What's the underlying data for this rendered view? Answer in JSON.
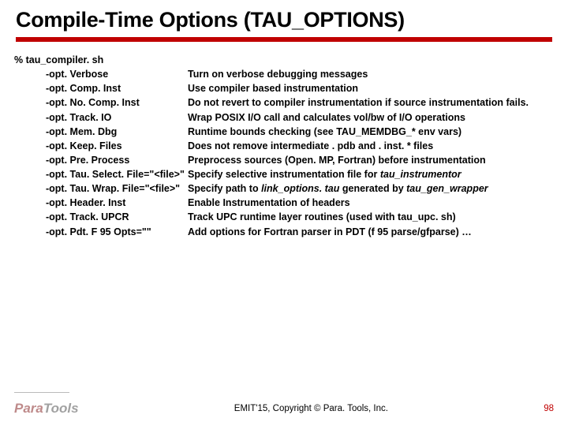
{
  "title": "Compile-Time Options (TAU_OPTIONS)",
  "cmd": "% tau_compiler. sh",
  "options": [
    {
      "flag": "-opt. Verbose",
      "desc": "Turn on verbose debugging messages"
    },
    {
      "flag": "-opt. Comp. Inst",
      "desc": "Use compiler based instrumentation"
    },
    {
      "flag": "-opt. No. Comp. Inst",
      "desc": "Do not revert to compiler instrumentation if source instrumentation fails."
    },
    {
      "flag": "-opt. Track. IO",
      "desc": "Wrap POSIX I/O call and calculates vol/bw of I/O operations"
    },
    {
      "flag": "-opt. Mem. Dbg",
      "desc": "Runtime bounds checking (see TAU_MEMDBG_* env vars)"
    },
    {
      "flag": "-opt. Keep. Files",
      "desc": "Does not remove intermediate . pdb and . inst. * files"
    },
    {
      "flag": "-opt. Pre. Process",
      "desc": "Preprocess sources (Open. MP, Fortran) before instrumentation"
    },
    {
      "flag": "-opt. Tau. Select. File=\"<file>\"",
      "desc_pre": "Specify selective instrumentation file for ",
      "desc_it": "tau_instrumentor"
    },
    {
      "flag": "-opt. Tau. Wrap. File=\"<file>\"",
      "desc_pre": "Specify path to ",
      "desc_it": "link_options. tau",
      "desc_post": " generated by ",
      "desc_it2": "tau_gen_wrapper"
    },
    {
      "flag": "-opt. Header. Inst",
      "desc": "Enable Instrumentation of headers"
    },
    {
      "flag": "-opt. Track. UPCR",
      "desc": "Track UPC runtime layer routines (used with tau_upc. sh)"
    },
    {
      "flag": "-opt. Pdt. F 95 Opts=\"\"",
      "desc": "Add options for Fortran parser in PDT (f 95 parse/gfparse) …"
    }
  ],
  "logo": {
    "para": "Para",
    "tools": "Tools"
  },
  "copyright": "EMIT'15, Copyright © Para. Tools, Inc.",
  "pagenum": "98"
}
